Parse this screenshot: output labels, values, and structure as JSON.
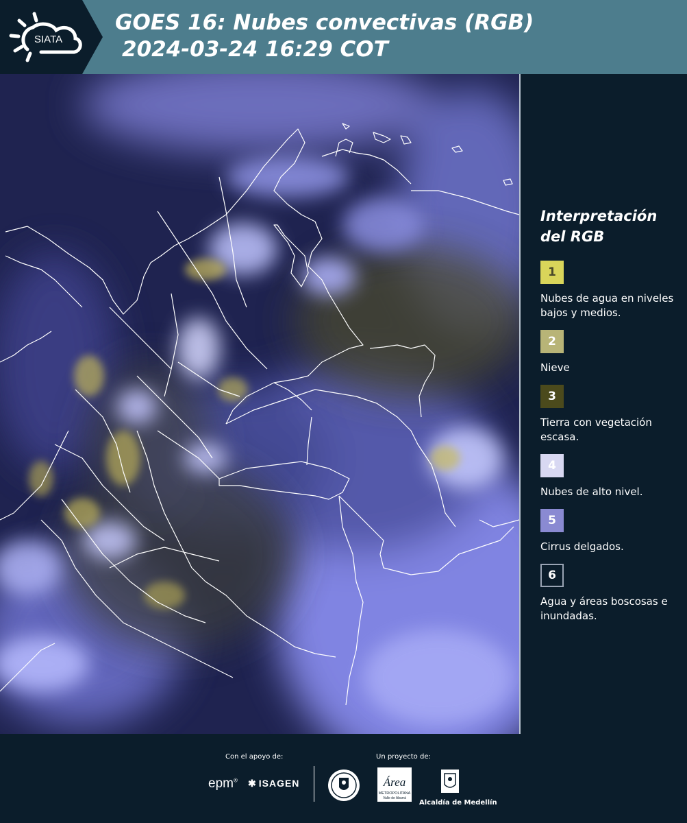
{
  "header": {
    "logo_text": "SIATA",
    "title": "GOES 16: Nubes convectivas (RGB)",
    "subtitle": "2024-03-24 16:29 COT"
  },
  "colors": {
    "header_bg": "#4d7d8d",
    "page_bg": "#0b1d2b",
    "map_base": "#1f2350",
    "cloud_high": "#8c8ff0",
    "cloud_low_yellow": "#bfb45a",
    "borders": "#ffffff"
  },
  "legend": {
    "title": "Interpretación del RGB",
    "items": [
      {
        "number": "1",
        "label": "Nubes de agua en niveles bajos y medios.",
        "color": "#d9d55a",
        "text_color": "#4a4a2a"
      },
      {
        "number": "2",
        "label": "Nieve",
        "color": "#b8b477",
        "text_color": "#ffffff"
      },
      {
        "number": "3",
        "label": "Tierra con vegetación escasa.",
        "color": "#4b4a1c",
        "text_color": "#ffffff"
      },
      {
        "number": "4",
        "label": "Nubes de alto nivel.",
        "color": "#d8d8f2",
        "text_color": "#ffffff"
      },
      {
        "number": "5",
        "label": "Cirrus delgados.",
        "color": "#8a8ad2",
        "text_color": "#ffffff"
      },
      {
        "number": "6",
        "label": "Agua y áreas boscosas e inundadas.",
        "color": "#0b1d2b",
        "text_color": "#ffffff",
        "border": "#9aa4b4"
      }
    ]
  },
  "footer": {
    "support_label": "Con el apoyo de:",
    "project_label": "Un proyecto de:",
    "epm_logo": "epm",
    "isagen_logo": "ISAGEN",
    "area_logo_text": "Área",
    "area_logo_sub": "METROPOLITANA",
    "area_logo_sub2": "Valle de Aburrá",
    "alcaldia_label": "Alcaldía de Medellín"
  }
}
